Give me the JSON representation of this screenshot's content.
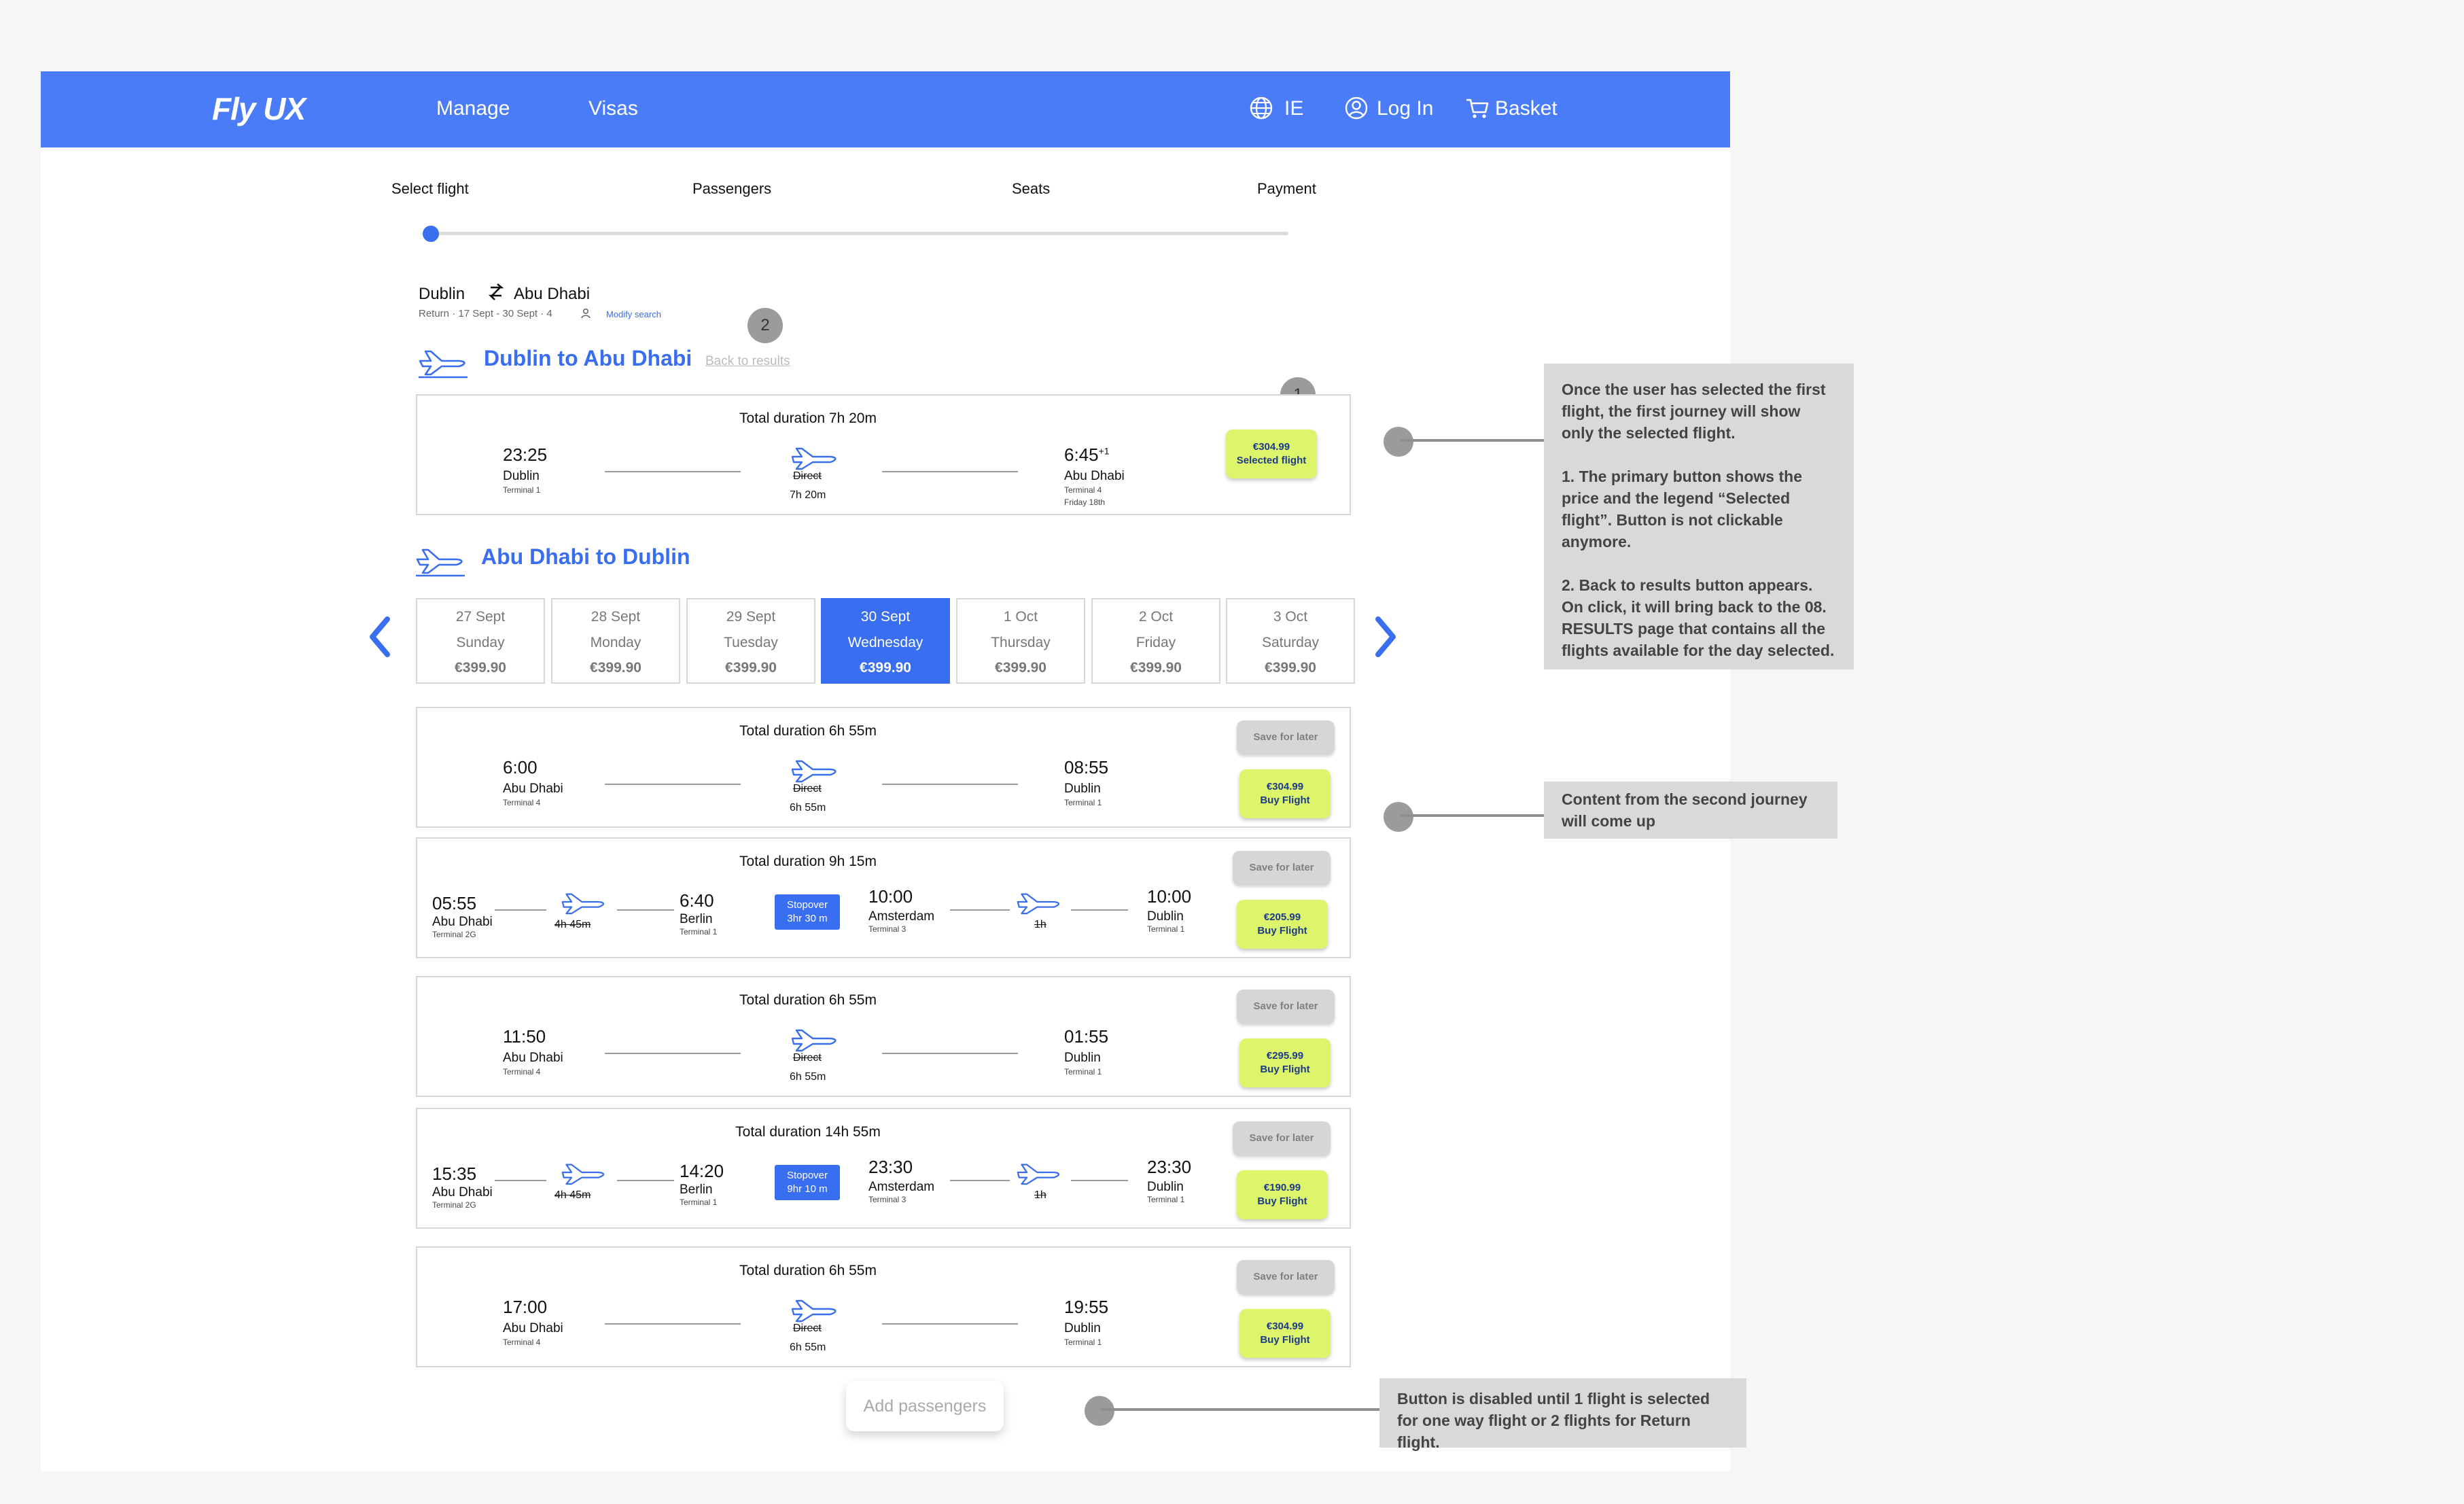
{
  "nav": {
    "logo": "Fly UX",
    "links": [
      "Manage",
      "Visas"
    ],
    "region": "IE",
    "login": "Log In",
    "basket": "Basket",
    "color": "#4a7cf7"
  },
  "steps": [
    "Select flight",
    "Passengers",
    "Seats",
    "Payment"
  ],
  "search": {
    "from": "Dublin",
    "to": "Abu Dhabi",
    "details": "Return · 17 Sept - 30 Sept · 4",
    "modify": "Modify search"
  },
  "outbound": {
    "title": "Dublin to Abu Dhabi",
    "back": "Back to results",
    "flight": {
      "duration": "Total duration 7h 20m",
      "dep_time": "23:25",
      "dep_city": "Dublin",
      "dep_term": "Terminal 1",
      "arr_time": "6:45",
      "arr_plus": "+1",
      "arr_city": "Abu Dhabi",
      "arr_term": "Terminal 4",
      "arr_day": "Friday 18th",
      "direct": "Direct",
      "leg_dur": "7h  20m",
      "price": "€304.99",
      "button": "Selected flight"
    }
  },
  "inbound": {
    "title": "Abu Dhabi to Dublin",
    "dates": [
      {
        "date": "27 Sept",
        "day": "Sunday",
        "price": "€399.90"
      },
      {
        "date": "28 Sept",
        "day": "Monday",
        "price": "€399.90"
      },
      {
        "date": "29 Sept",
        "day": "Tuesday",
        "price": "€399.90"
      },
      {
        "date": "30 Sept",
        "day": "Wednesday",
        "price": "€399.90"
      },
      {
        "date": "1 Oct",
        "day": "Thursday",
        "price": "€399.90"
      },
      {
        "date": "2 Oct",
        "day": "Friday",
        "price": "€399.90"
      },
      {
        "date": "3 Oct",
        "day": "Saturday",
        "price": "€399.90"
      }
    ],
    "save": "Save for later",
    "buy": "Buy Flight",
    "flights": [
      {
        "duration": "Total duration 6h 55m",
        "dep_time": "6:00",
        "dep_city": "Abu Dhabi",
        "dep_term": "Terminal 4",
        "arr_time": "08:55",
        "arr_city": "Dublin",
        "arr_term": "Terminal 1",
        "direct": "Direct",
        "leg_dur": "6h  55m",
        "price": "€304.99"
      },
      {
        "duration": "Total duration 9h 15m",
        "dep_time": "05:55",
        "dep_city": "Abu Dhabi",
        "dep_term": "Terminal 2G",
        "leg1_dur": "4h  45m",
        "mid_time": "6:40",
        "mid_city": "Berlin",
        "mid_term": "Terminal 1",
        "stop_label": "Stopover",
        "stop_dur": "3hr 30 m",
        "mid2_time": "10:00",
        "mid2_city": "Amsterdam",
        "mid2_term": "Terminal 3",
        "leg2_dur": "1h",
        "arr_time": "10:00",
        "arr_city": "Dublin",
        "arr_term": "Terminal 1",
        "price": "€205.99"
      },
      {
        "duration": "Total duration 6h 55m",
        "dep_time": "11:50",
        "dep_city": "Abu Dhabi",
        "dep_term": "Terminal 4",
        "arr_time": "01:55",
        "arr_city": "Dublin",
        "arr_term": "Terminal 1",
        "direct": "Direct",
        "leg_dur": "6h  55m",
        "price": "€295.99"
      },
      {
        "duration": "Total duration 14h 55m",
        "dep_time": "15:35",
        "dep_city": "Abu Dhabi",
        "dep_term": "Terminal 2G",
        "leg1_dur": "4h  45m",
        "mid_time": "14:20",
        "mid_city": "Berlin",
        "mid_term": "Terminal 1",
        "stop_label": "Stopover",
        "stop_dur": "9hr 10 m",
        "mid2_time": "23:30",
        "mid2_city": "Amsterdam",
        "mid2_term": "Terminal 3",
        "leg2_dur": "1h",
        "arr_time": "23:30",
        "arr_city": "Dublin",
        "arr_term": "Terminal 1",
        "price": "€190.99"
      },
      {
        "duration": "Total duration 6h 55m",
        "dep_time": "17:00",
        "dep_city": "Abu Dhabi",
        "dep_term": "Terminal 4",
        "arr_time": "19:55",
        "arr_city": "Dublin",
        "arr_term": "Terminal 1",
        "direct": "Direct",
        "leg_dur": "6h  55m",
        "price": "€304.99"
      }
    ]
  },
  "add_passengers": "Add passengers",
  "badges": [
    "1",
    "2"
  ],
  "annotations": [
    "Once the user has selected the first flight, the first journey will show only the selected flight.\n\n1. The primary button shows the price and the legend “Selected flight”. Button is not clickable anymore.\n\n2. Back to results button appears.\nOn click, it will bring back to the 08. RESULTS page that contains all the flights available for the day selected.",
    "Content from the second journey will come up",
    "Button is disabled until 1 flight is selected for one way flight or 2 flights for Return flight."
  ],
  "colors": {
    "accent": "#3a6ef0",
    "buy": "#ddf56a",
    "annotation": "#d9d9d9"
  }
}
